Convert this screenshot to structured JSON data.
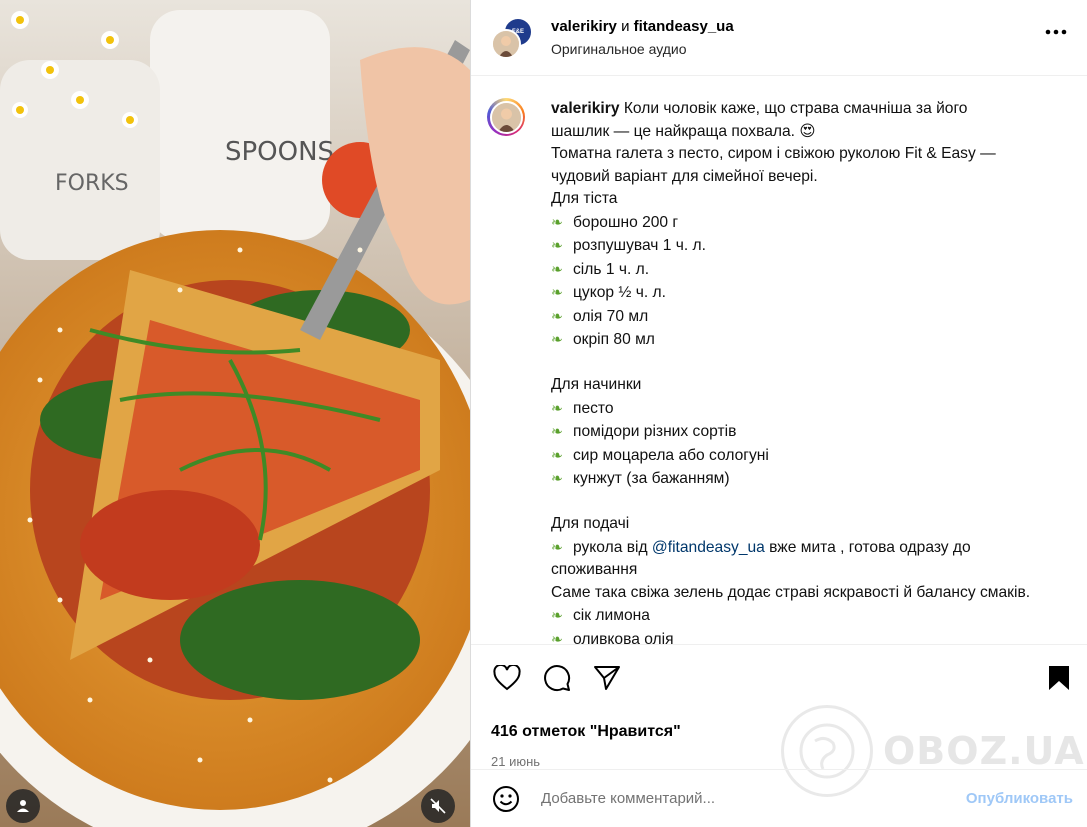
{
  "header": {
    "author": "valerikiry",
    "conj": "и",
    "coauthor": "fitandeasy_ua",
    "audio": "Оригинальное аудио",
    "coauthor_avatar_text": "F&E"
  },
  "caption": {
    "username": "valerikiry",
    "lines": [
      {
        "type": "first",
        "text": "Коли чоловік каже, що страва смачніша за його"
      },
      {
        "type": "text",
        "text": "шашлик — це найкраща похвала. 😍"
      },
      {
        "type": "text",
        "text": "Томатна галета з песто, сиром і свіжою руколою Fit & Easy —"
      },
      {
        "type": "text",
        "text": "чудовий варіант для сімейної вечері."
      },
      {
        "type": "text",
        "text": "Для тіста"
      },
      {
        "type": "item",
        "text": "борошно 200 г"
      },
      {
        "type": "item",
        "text": "розпушувач 1 ч. л."
      },
      {
        "type": "item",
        "text": "сіль 1 ч. л."
      },
      {
        "type": "item",
        "text": "цукор ½ ч. л."
      },
      {
        "type": "item",
        "text": "олія 70 мл"
      },
      {
        "type": "item",
        "text": "окріп 80 мл"
      },
      {
        "type": "blank",
        "text": ""
      },
      {
        "type": "text",
        "text": "Для начинки"
      },
      {
        "type": "item",
        "text": "песто"
      },
      {
        "type": "item",
        "text": "помідори різних сортів"
      },
      {
        "type": "item",
        "text": "сир моцарела або сологуні"
      },
      {
        "type": "item",
        "text": "кунжут (за бажанням)"
      },
      {
        "type": "blank",
        "text": ""
      },
      {
        "type": "text",
        "text": "Для подачі"
      },
      {
        "type": "mention",
        "before": "рукола від ",
        "mention": "@fitandeasy_ua",
        "after": " вже мита , готова одразу до"
      },
      {
        "type": "text",
        "text": "споживання"
      },
      {
        "type": "text",
        "text": "Саме така свіжа зелень додає страві яскравості й балансу смаків."
      },
      {
        "type": "item",
        "text": "сік лимона"
      },
      {
        "type": "item",
        "text": "оливкова олія"
      }
    ],
    "bullet_icon": "herb-icon"
  },
  "likes": "416 отметок \"Нравится\"",
  "date": "21 июнь",
  "comment": {
    "placeholder": "Добавьте комментарий...",
    "publish": "Опубликовать"
  },
  "watermark": "OBOZ.UA",
  "colors": {
    "link": "#00376b",
    "publish_disabled": "#9fc8f7",
    "muted": "#737373"
  }
}
